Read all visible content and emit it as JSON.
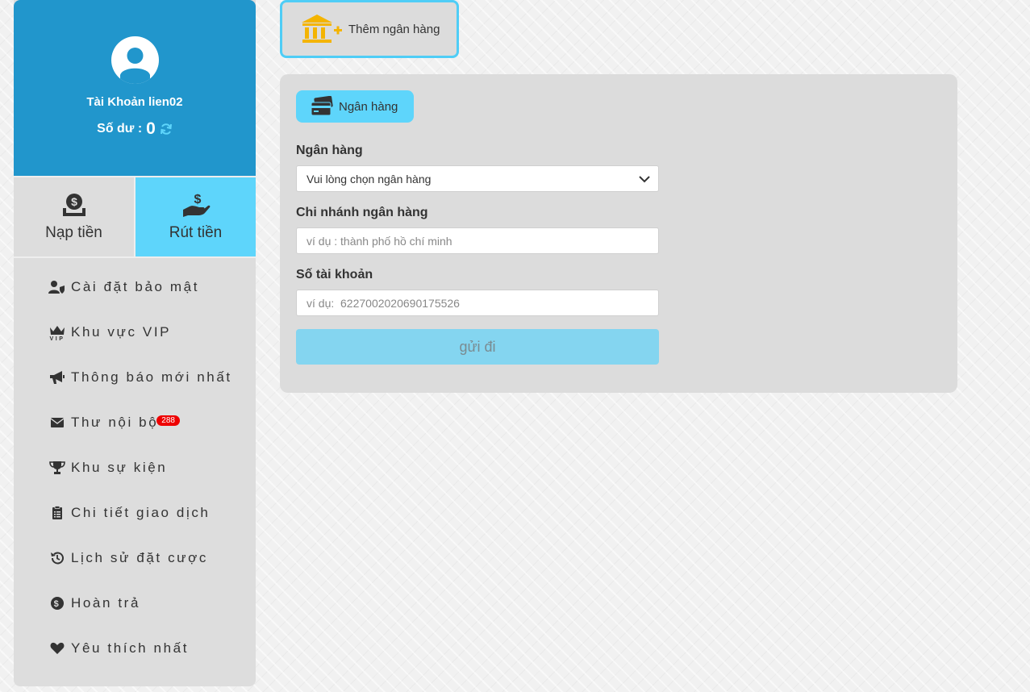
{
  "sidebar": {
    "account_label": "Tài Khoản lien02",
    "balance_label": "Số dư :",
    "balance_value": "0",
    "deposit_label": "Nạp tiền",
    "withdraw_label": "Rút tiền",
    "menu": [
      {
        "label": "Cài đặt bảo mật",
        "icon": "user-shield-icon"
      },
      {
        "label": "Khu vực VIP",
        "icon": "vip-crown-icon"
      },
      {
        "label": "Thông báo mới nhất",
        "icon": "megaphone-icon"
      },
      {
        "label": "Thư nội bộ",
        "icon": "envelope-icon",
        "badge": "288"
      },
      {
        "label": "Khu sự kiện",
        "icon": "trophy-icon"
      },
      {
        "label": "Chi tiết giao dịch",
        "icon": "clipboard-icon"
      },
      {
        "label": "Lịch sử đặt cược",
        "icon": "history-icon"
      },
      {
        "label": "Hoàn trả",
        "icon": "dollar-circle-icon"
      },
      {
        "label": "Yêu thích nhất",
        "icon": "heart-icon"
      }
    ]
  },
  "main": {
    "add_bank_label": "Thêm ngân hàng",
    "panel_tab_label": "Ngân hàng",
    "bank_label": "Ngân hàng",
    "bank_select_value": "Vui lòng chọn ngân hàng",
    "branch_label": "Chi nhánh ngân hàng",
    "branch_placeholder": "ví dụ : thành phố hồ chí minh",
    "account_number_label": "Số tài khoản",
    "account_number_placeholder": "ví dụ:  6227002020690175526",
    "submit_label": "gửi đi"
  },
  "colors": {
    "profile_bg": "#2196cc",
    "accent": "#5ed5fb",
    "bank_icon": "#f4b400",
    "badge": "#ee0000"
  }
}
